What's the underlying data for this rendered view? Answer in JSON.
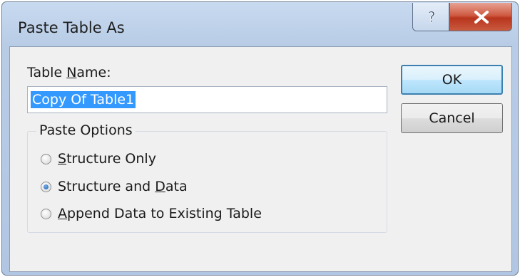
{
  "window": {
    "title": "Paste Table As"
  },
  "titlebar": {
    "help_glyph": "?",
    "close_glyph": "✕"
  },
  "form": {
    "table_name_label_pre": "Table ",
    "table_name_label_underlined": "N",
    "table_name_label_post": "ame:",
    "table_name_value": "Copy Of Table1"
  },
  "paste_options": {
    "title": "Paste Options",
    "options": [
      {
        "underlined": "S",
        "rest": "tructure Only",
        "selected": false
      },
      {
        "pre": "Structure and ",
        "underlined": "D",
        "rest": "ata",
        "selected": true
      },
      {
        "underlined": "A",
        "rest": "ppend Data to Existing Table",
        "selected": false
      }
    ]
  },
  "buttons": {
    "ok": "OK",
    "cancel": "Cancel"
  }
}
